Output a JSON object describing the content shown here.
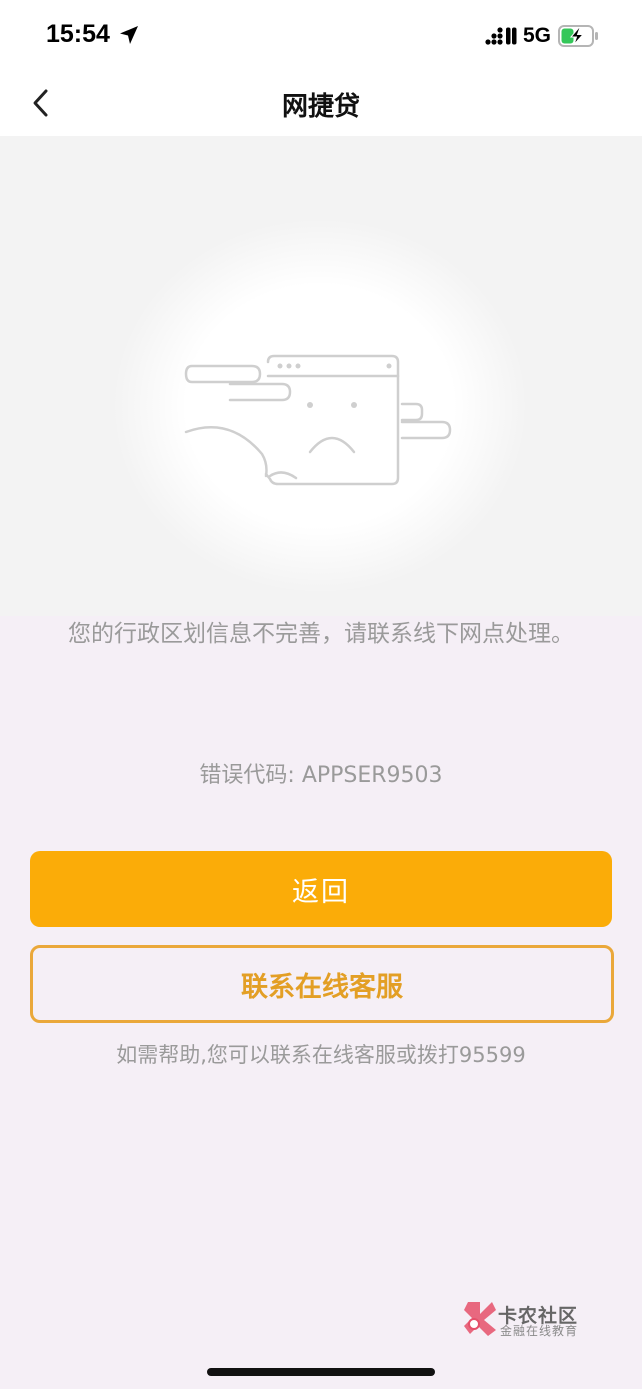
{
  "status_bar": {
    "time": "15:54",
    "network": "5G",
    "icons": [
      "location-arrow-icon",
      "signal-icon",
      "battery-charging-icon"
    ],
    "battery_color": "#34c759"
  },
  "nav": {
    "title": "网捷贷",
    "back_icon": "chevron-left-icon"
  },
  "illustration": {
    "icon": "sad-browser-window-illustration"
  },
  "error": {
    "message": "您的行政区划信息不完善，请联系线下网点处理。",
    "code": "错误代码: APPSER9503"
  },
  "buttons": {
    "back_label": "返回",
    "contact_label": "联系在线客服"
  },
  "help_text": "如需帮助,您可以联系在线客服或拨打95599",
  "watermark": {
    "title": "卡农社区",
    "subtitle": "金融在线教育"
  },
  "colors": {
    "accent": "#fbac08",
    "outline": "#eaa83a",
    "background": "#f5eff6",
    "muted_text": "#9a9a9a"
  }
}
